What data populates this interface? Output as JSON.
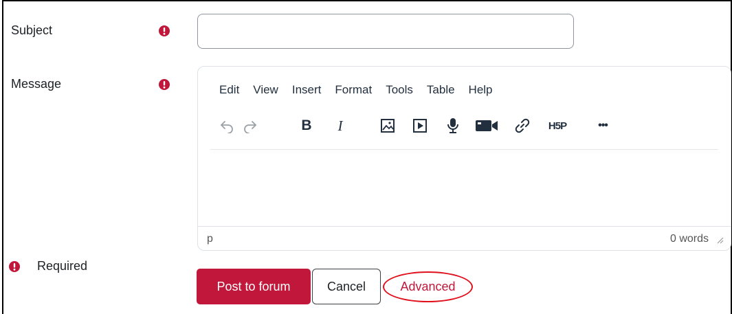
{
  "form": {
    "subject_label": "Subject",
    "message_label": "Message",
    "subject_value": "",
    "required_label": "Required"
  },
  "editor": {
    "menu": [
      "Edit",
      "View",
      "Insert",
      "Format",
      "Tools",
      "Table",
      "Help"
    ],
    "toolbar": {
      "bold": "B",
      "italic": "I",
      "h5p": "H5P",
      "more": "•••"
    },
    "status_path": "p",
    "word_count": "0 words"
  },
  "buttons": {
    "post": "Post to forum",
    "cancel": "Cancel",
    "advanced": "Advanced"
  },
  "colors": {
    "primary": "#c0173a",
    "required_icon": "#c0173a",
    "highlight_circle": "#e0101c"
  }
}
